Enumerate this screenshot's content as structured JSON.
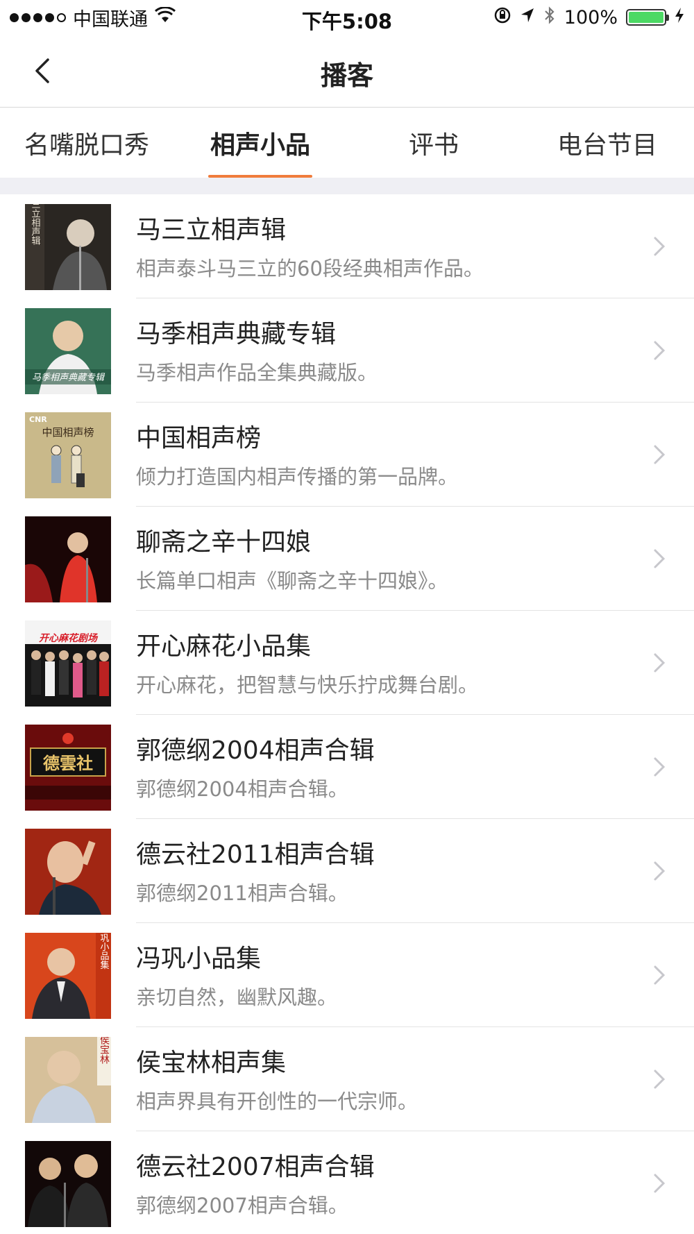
{
  "status_bar": {
    "carrier": "中国联通",
    "time": "下午5:08",
    "battery_percent": "100%",
    "icons": [
      "signal-dots-icon",
      "wifi-icon",
      "orientation-lock-icon",
      "location-arrow-icon",
      "bluetooth-icon",
      "battery-icon",
      "charging-bolt-icon"
    ]
  },
  "nav": {
    "title": "播客",
    "back_icon": "chevron-left-icon"
  },
  "tabs": [
    {
      "label": "名嘴脱口秀",
      "active": false
    },
    {
      "label": "相声小品",
      "active": true
    },
    {
      "label": "评书",
      "active": false
    },
    {
      "label": "电台节目",
      "active": false
    }
  ],
  "colors": {
    "accent": "#f07c3c",
    "divider": "#e3e3e3",
    "section_gap": "#efeff4",
    "subtitle": "#8a8a8a"
  },
  "items": [
    {
      "title": "马三立相声辑",
      "desc": "相声泰斗马三立的60段经典相声作品。",
      "cover_text": "马三立相声辑"
    },
    {
      "title": "马季相声典藏专辑",
      "desc": "马季相声作品全集典藏版。",
      "cover_text": "马季相声典藏专辑"
    },
    {
      "title": "中国相声榜",
      "desc": "倾力打造国内相声传播的第一品牌。",
      "cover_text": "中国相声榜"
    },
    {
      "title": "聊斋之辛十四娘",
      "desc": "长篇单口相声《聊斋之辛十四娘》。",
      "cover_text": ""
    },
    {
      "title": "开心麻花小品集",
      "desc": "开心麻花，把智慧与快乐拧成舞台剧。",
      "cover_text": "开心麻花剧场"
    },
    {
      "title": "郭德纲2004相声合辑",
      "desc": "郭德纲2004相声合辑。",
      "cover_text": "德雲社"
    },
    {
      "title": "德云社2011相声合辑",
      "desc": "郭德纲2011相声合辑。",
      "cover_text": ""
    },
    {
      "title": "冯巩小品集",
      "desc": "亲切自然，幽默风趣。",
      "cover_text": "冯巩小品集"
    },
    {
      "title": "侯宝林相声集",
      "desc": "相声界具有开创性的一代宗师。",
      "cover_text": "侯宝林"
    },
    {
      "title": "德云社2007相声合辑",
      "desc": "郭德纲2007相声合辑。",
      "cover_text": ""
    }
  ]
}
